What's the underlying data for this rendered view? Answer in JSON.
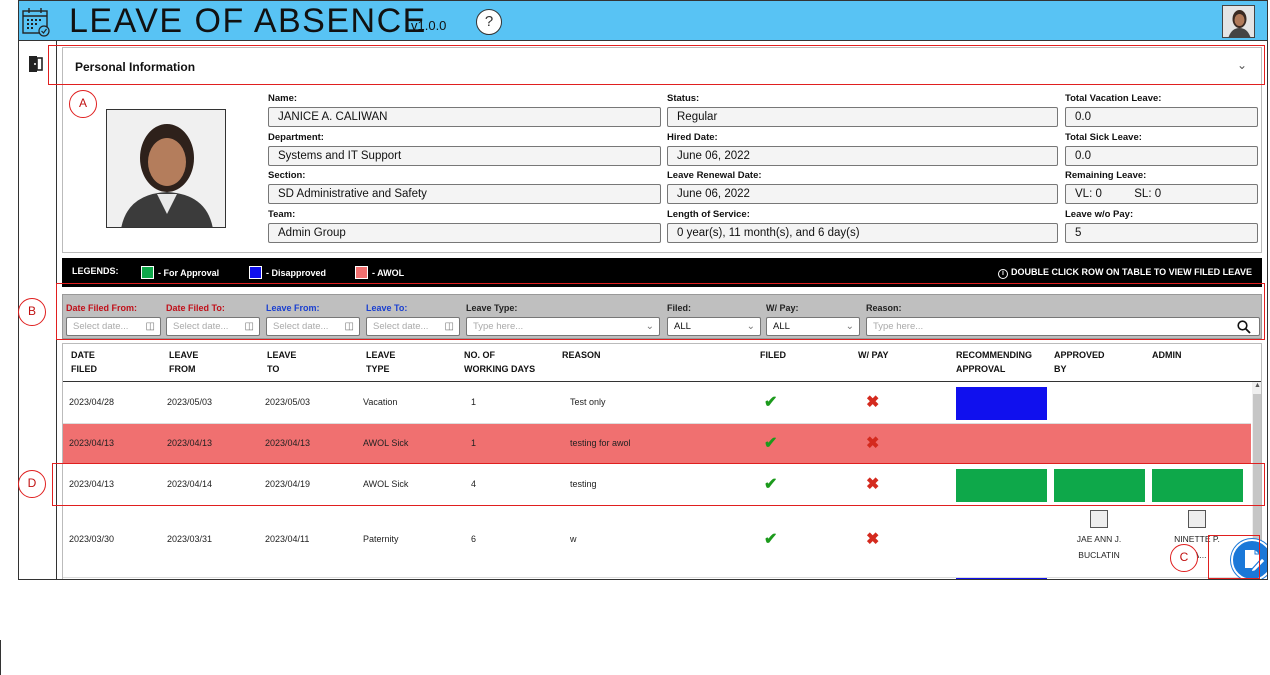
{
  "header": {
    "title": "LEAVE OF ABSENCE",
    "version": "v1.0.0",
    "help_label": "?"
  },
  "personal_info": {
    "title": "Personal Information",
    "fields": {
      "name": {
        "label": "Name:",
        "value": "JANICE A. CALIWAN"
      },
      "department": {
        "label": "Department:",
        "value": "Systems and IT Support"
      },
      "section": {
        "label": "Section:",
        "value": "SD Administrative and Safety"
      },
      "team": {
        "label": "Team:",
        "value": "Admin Group"
      },
      "status": {
        "label": "Status:",
        "value": "Regular"
      },
      "hired_date": {
        "label": "Hired Date:",
        "value": "June 06, 2022"
      },
      "renewal_date": {
        "label": "Leave Renewal Date:",
        "value": "June 06, 2022"
      },
      "length_of_service": {
        "label": "Length of Service:",
        "value": "0 year(s), 11 month(s), and 6 day(s)"
      },
      "total_vacation": {
        "label": "Total Vacation Leave:",
        "value": "0.0"
      },
      "total_sick": {
        "label": "Total Sick Leave:",
        "value": "0.0"
      },
      "remaining": {
        "label": "Remaining Leave:",
        "vl": "VL: 0",
        "sl": "SL: 0"
      },
      "leave_wo_pay": {
        "label": "Leave w/o Pay:",
        "value": "5"
      }
    }
  },
  "legends": {
    "title": "LEGENDS:",
    "items": [
      {
        "label": "- For Approval",
        "color": "#0ea84a"
      },
      {
        "label": "- Disapproved",
        "color": "#1010ee"
      },
      {
        "label": "- AWOL",
        "color": "#f07070"
      }
    ],
    "note": "DOUBLE CLICK ROW ON TABLE TO VIEW FILED LEAVE"
  },
  "filters": {
    "date_filed_from": {
      "label": "Date Filed From:",
      "placeholder": "Select date...",
      "color": "#c0101a"
    },
    "date_filed_to": {
      "label": "Date Filed To:",
      "placeholder": "Select date...",
      "color": "#c0101a"
    },
    "leave_from": {
      "label": "Leave From:",
      "placeholder": "Select date...",
      "color": "#1a3fd0"
    },
    "leave_to": {
      "label": "Leave To:",
      "placeholder": "Select date...",
      "color": "#1a3fd0"
    },
    "leave_type": {
      "label": "Leave Type:",
      "placeholder": "Type here..."
    },
    "filed": {
      "label": "Filed:",
      "value": "ALL"
    },
    "w_pay": {
      "label": "W/ Pay:",
      "value": "ALL"
    },
    "reason": {
      "label": "Reason:",
      "placeholder": "Type here..."
    }
  },
  "table": {
    "headers": {
      "date_filed": [
        "DATE",
        "FILED"
      ],
      "leave_from": [
        "LEAVE",
        "FROM"
      ],
      "leave_to": [
        "LEAVE",
        "TO"
      ],
      "leave_type": [
        "LEAVE",
        "TYPE"
      ],
      "working_days": [
        "NO. OF",
        "WORKING DAYS"
      ],
      "reason": [
        "REASON",
        ""
      ],
      "filed": [
        "FILED",
        ""
      ],
      "w_pay": [
        "W/ PAY",
        ""
      ],
      "recommending": [
        "RECOMMENDING",
        "APPROVAL"
      ],
      "approved_by": [
        "APPROVED",
        "BY"
      ],
      "admin": [
        "ADMIN",
        ""
      ]
    },
    "rows": [
      {
        "date_filed": "2023/04/28",
        "leave_from": "2023/05/03",
        "leave_to": "2023/05/03",
        "leave_type": "Vacation",
        "days": "1",
        "reason": "Test only"
      },
      {
        "date_filed": "2023/04/13",
        "leave_from": "2023/04/13",
        "leave_to": "2023/04/13",
        "leave_type": "AWOL Sick",
        "days": "1",
        "reason": "testing for awol"
      },
      {
        "date_filed": "2023/04/13",
        "leave_from": "2023/04/14",
        "leave_to": "2023/04/19",
        "leave_type": "AWOL Sick",
        "days": "4",
        "reason": "testing"
      },
      {
        "date_filed": "2023/03/30",
        "leave_from": "2023/03/31",
        "leave_to": "2023/04/11",
        "leave_type": "Paternity",
        "days": "6",
        "reason": "w",
        "approved_by": [
          "JAE ANN J.",
          "BUCLATIN"
        ],
        "admin": [
          "NINETTE P.",
          "DA..."
        ]
      }
    ]
  },
  "annotations": {
    "a": "A",
    "b": "B",
    "c": "C",
    "d": "D"
  },
  "colors": {
    "header_bg": "#58c3f4",
    "for_approval": "#0ea84a",
    "disapproved": "#1010ee",
    "awol_row": "#f07070",
    "fab": "#1a78d8",
    "annotation": "#e01f1f"
  }
}
